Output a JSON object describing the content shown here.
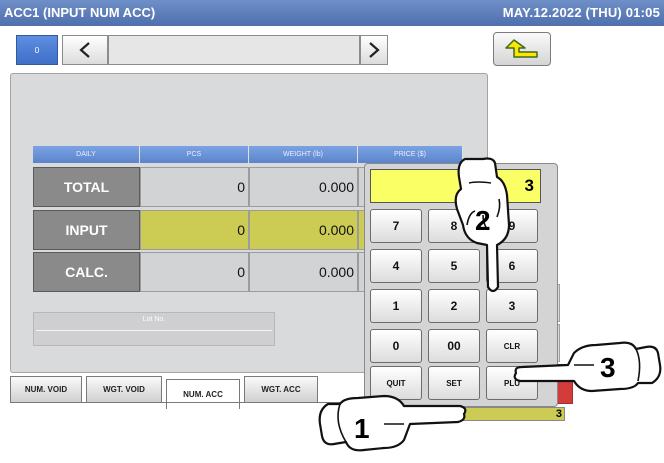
{
  "titlebar": {
    "title": "ACC1 (INPUT NUM ACC)",
    "datetime": "MAY.12.2022 (THU) 01:05"
  },
  "nav": {
    "number": "0",
    "prev_icon": "chevron-left-icon",
    "next_icon": "chevron-right-icon",
    "back_icon": "return-arrow-icon"
  },
  "table": {
    "headers": [
      "DAILY",
      "PCS",
      "WEIGHT (lb)",
      "PRICE ($)"
    ],
    "rows": [
      {
        "label": "TOTAL",
        "pcs": "0",
        "weight": "0.000"
      },
      {
        "label": "INPUT",
        "pcs": "0",
        "weight": "0.000"
      },
      {
        "label": "CALC.",
        "pcs": "0",
        "weight": "0.000"
      }
    ]
  },
  "lot": {
    "label": "Lot No."
  },
  "tabs": [
    "NUM. VOID",
    "WGT. VOID",
    "NUM. ACC",
    "WGT. ACC"
  ],
  "active_tab": "NUM. ACC",
  "keypad": {
    "display": "3",
    "keys": [
      "7",
      "8",
      "9",
      "4",
      "5",
      "6",
      "1",
      "2",
      "3",
      "0",
      "00",
      "CLR",
      "QUIT",
      "SET",
      "PLU"
    ]
  },
  "bottom_field": "3",
  "steps": [
    "1",
    "2",
    "3"
  ],
  "colors": {
    "title_bar": "#5a7bbb",
    "header_blue": "#6b94d8",
    "highlight_yellow": "#cccc55",
    "display_yellow": "#fbff66",
    "alert_red": "#d43b3b"
  }
}
